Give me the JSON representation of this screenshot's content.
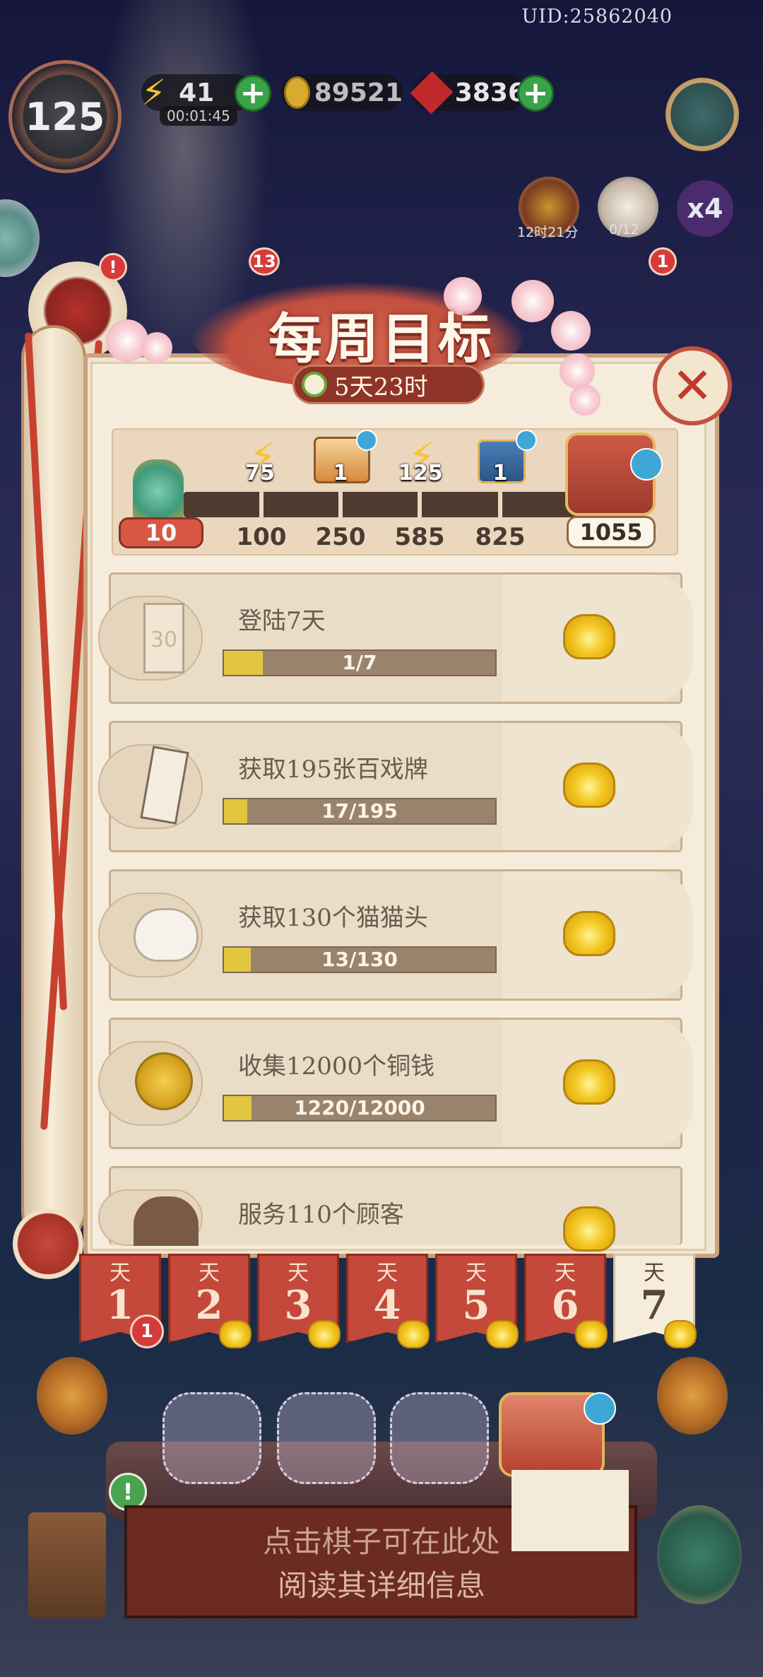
{
  "header": {
    "uid": "UID:25862040",
    "level": "125",
    "energy": "41",
    "energy_timer": "00:01:45",
    "coins": "89521",
    "gems": "3836",
    "plus": "+",
    "event1_label": "12时21分",
    "event2_label": "0/12",
    "multiplier": "x4",
    "badge_a": "!",
    "badge_b": "13",
    "badge_c": "1"
  },
  "modal": {
    "title": "每周目标",
    "countdown": "5天23时",
    "close": "✕"
  },
  "milestones": {
    "current_points": "10",
    "items": [
      {
        "qty": "75",
        "points": "100",
        "icon": "energy-icon"
      },
      {
        "qty": "1",
        "points": "250",
        "icon": "food-box-icon"
      },
      {
        "qty": "125",
        "points": "585",
        "icon": "energy-icon"
      },
      {
        "qty": "1",
        "points": "825",
        "icon": "mystery-chest-icon"
      }
    ],
    "final_points": "1055"
  },
  "tasks": [
    {
      "title": "登陆7天",
      "progress": "1/7",
      "fraction": 0.143,
      "icon": "calendar-icon",
      "icon_text": "30"
    },
    {
      "title": "获取195张百戏牌",
      "progress": "17/195",
      "fraction": 0.087,
      "icon": "card-icon"
    },
    {
      "title": "获取130个猫猫头",
      "progress": "13/130",
      "fraction": 0.1,
      "icon": "cat-head-icon"
    },
    {
      "title": "收集12000个铜钱",
      "progress": "1220/12000",
      "fraction": 0.102,
      "icon": "copper-coin-icon"
    },
    {
      "title": "服务110个顾客",
      "icon": "customer-icon"
    }
  ],
  "days": [
    {
      "label": "天",
      "num": "1",
      "badge": "1"
    },
    {
      "label": "天",
      "num": "2"
    },
    {
      "label": "天",
      "num": "3"
    },
    {
      "label": "天",
      "num": "4"
    },
    {
      "label": "天",
      "num": "5"
    },
    {
      "label": "天",
      "num": "6"
    },
    {
      "label": "天",
      "num": "7"
    }
  ],
  "bottom": {
    "info_line1": "点击棋子可在此处",
    "info_line2": "阅读其详细信息",
    "alert": "!"
  },
  "colors": {
    "accent_red": "#c4493a",
    "parchment": "#efe5d3",
    "progress_fill": "#e2c63f",
    "gold": "#f4c720"
  }
}
